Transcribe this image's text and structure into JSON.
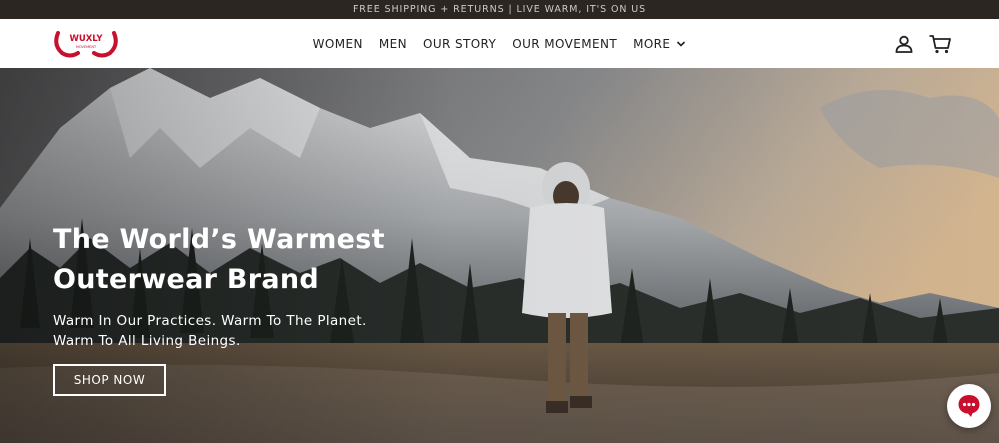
{
  "announcement": {
    "text": "FREE SHIPPING + RETURNS | LIVE WARM, IT'S ON US"
  },
  "brand": {
    "name": "WUXLY",
    "tagline": "MOVEMENT",
    "color": "#c8102e"
  },
  "nav": {
    "items": [
      {
        "label": "WOMEN"
      },
      {
        "label": "MEN"
      },
      {
        "label": "OUR STORY"
      },
      {
        "label": "OUR MOVEMENT"
      },
      {
        "label": "MORE"
      }
    ]
  },
  "header_icons": {
    "account": "user-icon",
    "cart": "cart-icon"
  },
  "hero": {
    "title_line1": "The World’s Warmest",
    "title_line2": "Outerwear Brand",
    "sub_line1": "Warm In Our Practices. Warm To The Planet.",
    "sub_line2": "Warm To All Living Beings.",
    "cta_label": "SHOP NOW"
  },
  "chat": {
    "icon": "chat-bubble-icon",
    "color": "#c8102e"
  }
}
